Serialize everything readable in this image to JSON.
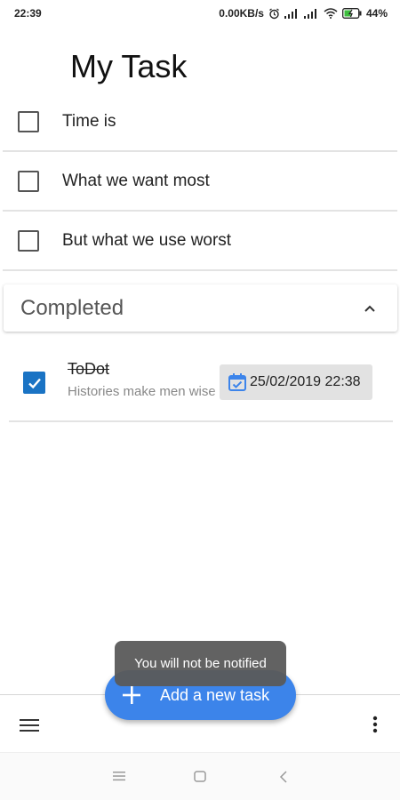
{
  "status_bar": {
    "time": "22:39",
    "network_speed": "0.00KB/s",
    "battery": "44%"
  },
  "page": {
    "title": "My Task"
  },
  "tasks": [
    {
      "label": "Time is",
      "checked": false
    },
    {
      "label": "What we want most",
      "checked": false
    },
    {
      "label": "But what we use worst",
      "checked": false
    }
  ],
  "completed": {
    "header": "Completed",
    "items": [
      {
        "title": "ToDot",
        "subtitle": "Histories make men wise",
        "date": "25/02/2019 22:38",
        "checked": true
      }
    ]
  },
  "fab": {
    "label": "Add a new task"
  },
  "toast": {
    "message": "You will not be notified"
  },
  "colors": {
    "accent": "#3c84ea",
    "checkbox_checked": "#1a73c4",
    "toast_bg": "#5a5a5a"
  },
  "icons": [
    "alarm-icon",
    "signal-icon",
    "wifi-icon",
    "battery-icon",
    "chevron-up-icon",
    "check-icon",
    "calendar-icon",
    "plus-icon",
    "menu-icon",
    "more-vertical-icon",
    "nav-recents-icon",
    "nav-home-icon",
    "nav-back-icon"
  ]
}
